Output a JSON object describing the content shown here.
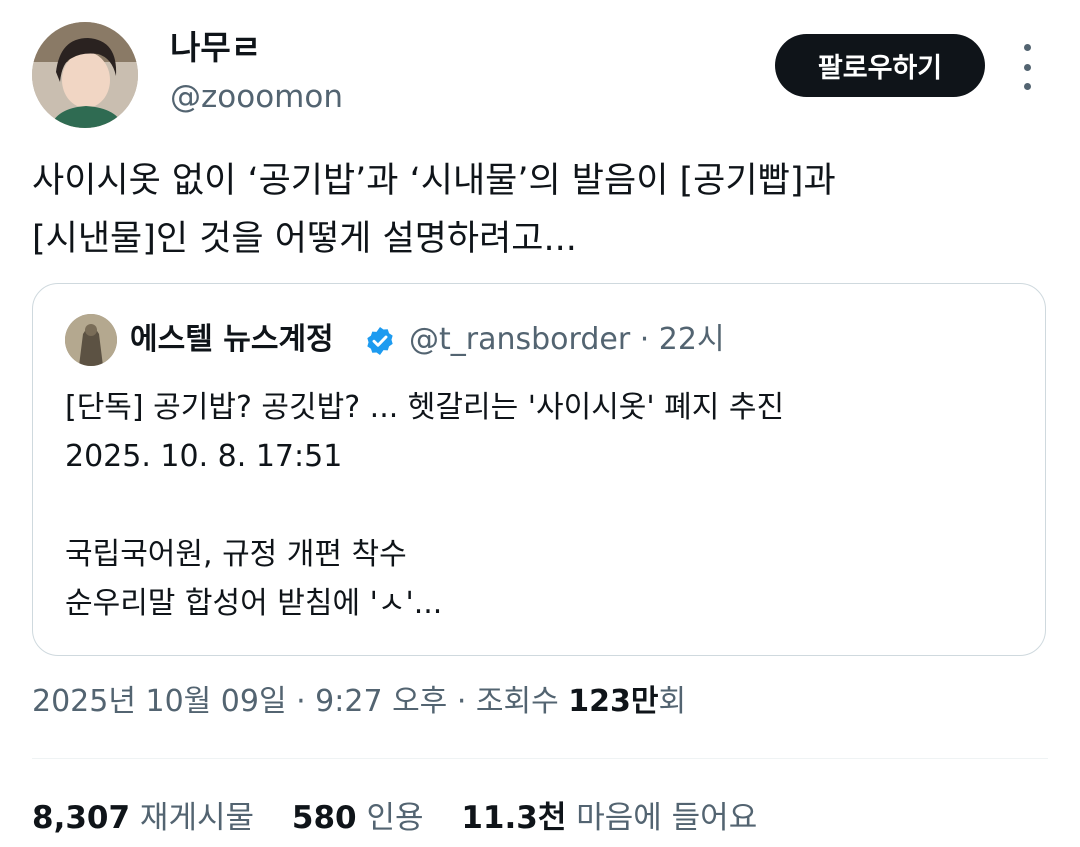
{
  "author": {
    "name": "나무ㄹ",
    "handle": "@zooomon",
    "follow_label": "팔로우하기"
  },
  "tweet": {
    "lines": [
      "사이시옷 없이 ‘공기밥’과 ‘시내물’의 발음이 [공기빱]과",
      "[시낸물]인 것을 어떻게 설명하려고..."
    ]
  },
  "quote": {
    "name": "에스텔 뉴스계정",
    "handle": "@t_ransborder",
    "time": "· 22시",
    "lines": [
      "[단독] 공기밥? 공깃밥? ... 헷갈리는 '사이시옷' 폐지 추진",
      "2025. 10. 8. 17:51",
      "",
      "국립국어원, 규정 개편 착수",
      "순우리말 합성어 받침에 'ㅅ'..."
    ],
    "verified_color": "#1d9bf0"
  },
  "meta": {
    "datetime": "2025년 10월 09일 · 9:27 오후 · 조회수 ",
    "views_num": "123만",
    "views_suffix": "회"
  },
  "stats": {
    "reposts_num": "8,307",
    "reposts_label": "재게시물",
    "quotes_num": "580",
    "quotes_label": "인용",
    "likes_num": "11.3천",
    "likes_label": "마음에 들어요"
  },
  "icons": {
    "verified": "verified-badge-icon",
    "more": "more-options-icon"
  }
}
